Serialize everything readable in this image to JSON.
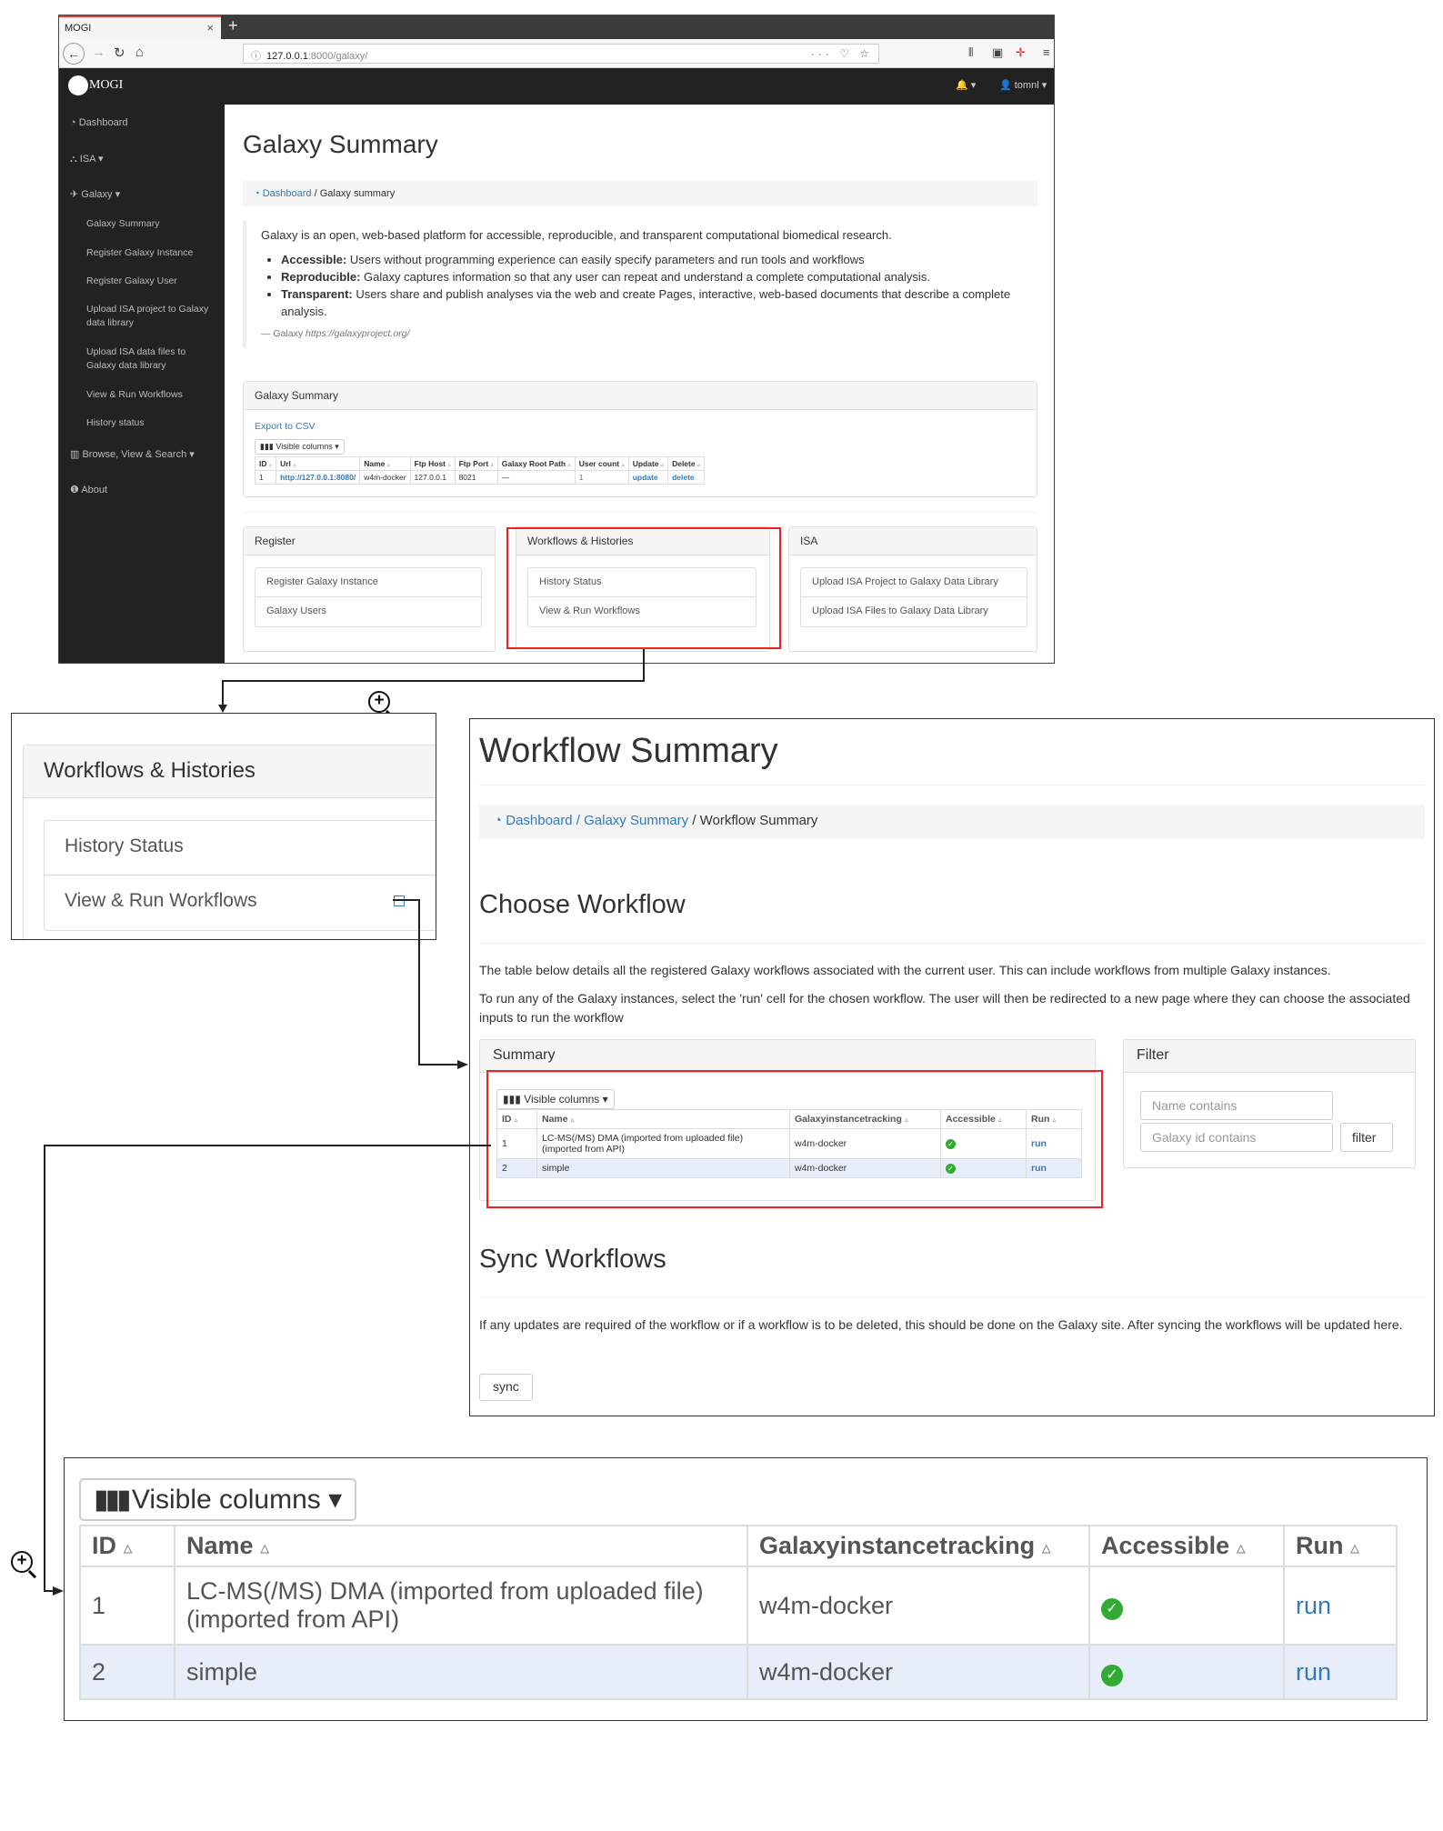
{
  "browser": {
    "tab_title": "MOGI",
    "tab_close": "×",
    "tab_new": "+",
    "url_host": "127.0.0.1",
    "url_rest": ":8000/galaxy/",
    "url_icons": "··· ♡ ☆"
  },
  "app": {
    "logo_text": "MOGI",
    "bell_label": "🔔 ▾",
    "user_label": "👤 tomnl ▾"
  },
  "sidebar": {
    "dashboard": "Dashboard",
    "isa": "ISA",
    "galaxy": "Galaxy",
    "sub_items": [
      "Galaxy Summary",
      "Register Galaxy Instance",
      "Register Galaxy User",
      "Upload ISA project to Galaxy data library",
      "Upload ISA data files to Galaxy data library",
      "View & Run Workflows",
      "History status"
    ],
    "browse": "Browse, View & Search",
    "about": "About"
  },
  "galaxy_summary": {
    "title": "Galaxy Summary",
    "bc_link": "Dashboard",
    "bc_rest": " / Galaxy summary",
    "intro": "Galaxy is an open, web-based platform for accessible, reproducible, and transparent computational biomedical research.",
    "bullets": [
      {
        "term": "Accessible:",
        "text": " Users without programming experience can easily specify parameters and run tools and workflows"
      },
      {
        "term": "Reproducible:",
        "text": " Galaxy captures information so that any user can repeat and understand a complete computational analysis."
      },
      {
        "term": "Transparent:",
        "text": " Users share and publish analyses via the web and create Pages, interactive, web-based documents that describe a complete analysis."
      }
    ],
    "cite_prefix": "— Galaxy ",
    "cite_url": "https://galaxyproject.org/",
    "panel_title": "Galaxy Summary",
    "export": "Export to CSV",
    "visible_columns": "Visible columns ▾",
    "columns": [
      "ID",
      "Url",
      "Name",
      "Ftp Host",
      "Ftp Port",
      "Galaxy Root Path",
      "User count",
      "Update",
      "Delete"
    ],
    "row": [
      "1",
      "http://127.0.0.1:8080/",
      "w4m-docker",
      "127.0.0.1",
      "8021",
      "—",
      "1",
      "update",
      "delete"
    ]
  },
  "cards": {
    "register": {
      "title": "Register",
      "items": [
        "Register Galaxy Instance",
        "Galaxy Users"
      ]
    },
    "workflows": {
      "title": "Workflows & Histories",
      "items": [
        "History Status",
        "View & Run Workflows"
      ]
    },
    "isa": {
      "title": "ISA",
      "items": [
        "Upload ISA Project to Galaxy Data Library",
        "Upload ISA Files to Galaxy Data Library"
      ]
    }
  },
  "workflow_summary": {
    "title": "Workflow Summary",
    "bc_link": "Dashboard / Galaxy Summary",
    "bc_rest": " / Workflow Summary",
    "choose_title": "Choose Workflow",
    "para1": "The table below details all the registered Galaxy workflows associated with the current user. This can include workflows from multiple Galaxy instances.",
    "para2": "To run any of the Galaxy instances, select the 'run' cell for the chosen workflow. The user will then be redirected to a new page where they can choose the associated inputs to run the workflow",
    "summary_title": "Summary",
    "filter_title": "Filter",
    "name_placeholder": "Name contains",
    "galaxy_id_placeholder": "Galaxy id contains",
    "filter_button": "filter",
    "sync_title": "Sync Workflows",
    "sync_para": "If any updates are required of the workflow or if a workflow is to be deleted, this should be done on the Galaxy site. After syncing the workflows will be updated here.",
    "sync_button": "sync"
  },
  "workflow_table": {
    "visible_columns": "Visible columns ▾",
    "columns": [
      "ID",
      "Name",
      "Galaxyinstancetracking",
      "Accessible",
      "Run"
    ],
    "rows": [
      {
        "id": "1",
        "name": "LC-MS(/MS) DMA (imported from uploaded file) (imported from API)",
        "galaxy": "w4m-docker",
        "run": "run"
      },
      {
        "id": "2",
        "name": "simple",
        "galaxy": "w4m-docker",
        "run": "run"
      }
    ]
  },
  "icons": [
    "arrow-back-icon",
    "arrow-forward-icon",
    "reload-icon",
    "home-icon",
    "info-icon",
    "bell-icon",
    "user-icon",
    "dashboard-icon",
    "sitemap-icon",
    "plane-icon",
    "bar-chart-icon",
    "info-circle-icon",
    "columns-icon",
    "check-circle-icon",
    "zoom-in-icon"
  ],
  "colors": {
    "link": "#337ab7",
    "highlight_red": "#e22222",
    "sidebar_bg": "#222222",
    "check_green": "#33aa33",
    "row_highlight": "#e8eef9"
  }
}
